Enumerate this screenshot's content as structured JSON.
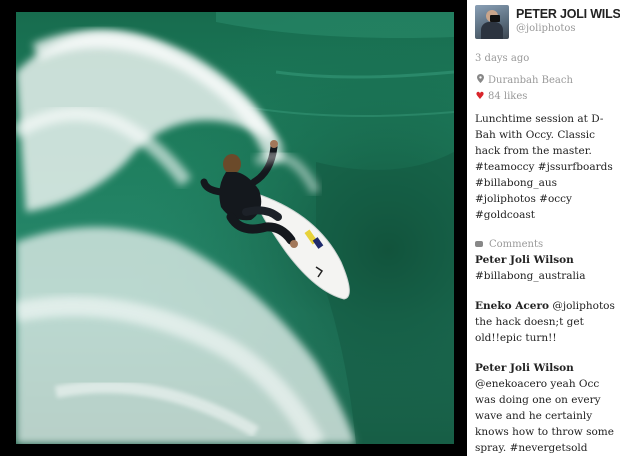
{
  "profile": {
    "name": "PETER JOLI WILSON",
    "handle": "@joliphotos"
  },
  "post": {
    "time_ago": "3 days ago",
    "location": "Duranbah Beach",
    "likes": "84 likes",
    "caption": "Lunchtime session at D-Bah with Occy. Classic hack from the master. #teamoccy #jssurfboards #billabong_aus #joliphotos #occy #goldcoast"
  },
  "comments_label": "Comments",
  "comments": [
    {
      "author": "Peter Joli Wilson",
      "text": "#billabong_australia"
    },
    {
      "author": "Eneko Acero",
      "text": "@joliphotos the hack doesn;t get old!!epic turn!!"
    },
    {
      "author": "Peter Joli Wilson",
      "text": "@enekoacero yeah Occ was doing one on every wave and he certainly knows how to throw some spray. #nevergetsold"
    }
  ],
  "colors": {
    "like_heart": "#d9252b",
    "meta_gray": "#999999",
    "wave_green": "#1f7f5f"
  },
  "icons": {
    "location": "location-pin-icon",
    "likes": "heart-icon",
    "comments": "comment-bubble-icon"
  }
}
